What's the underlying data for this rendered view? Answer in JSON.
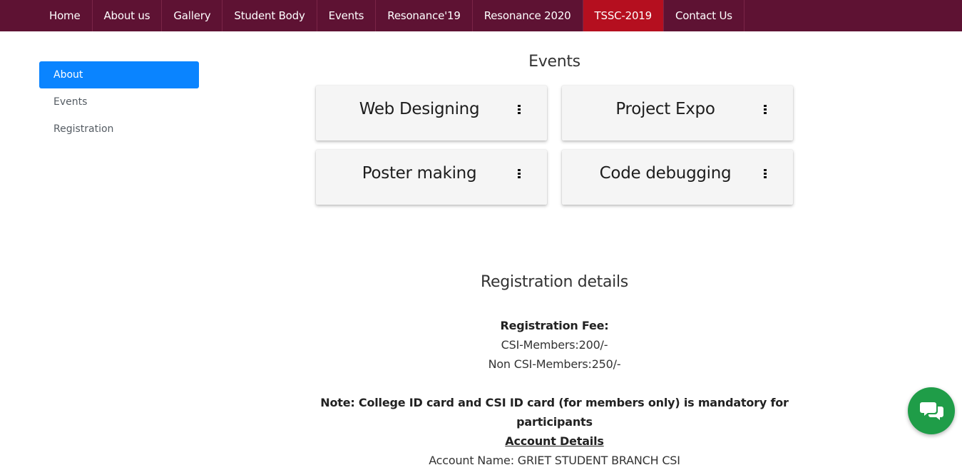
{
  "nav": {
    "items": [
      {
        "label": "Home"
      },
      {
        "label": "About us"
      },
      {
        "label": "Gallery"
      },
      {
        "label": "Student Body"
      },
      {
        "label": "Events"
      },
      {
        "label": "Resonance'19"
      },
      {
        "label": "Resonance 2020"
      },
      {
        "label": "TSSC-2019",
        "active": true
      },
      {
        "label": "Contact Us"
      }
    ]
  },
  "sidebar": {
    "items": [
      {
        "label": "About",
        "active": true
      },
      {
        "label": "Events"
      },
      {
        "label": "Registration"
      }
    ]
  },
  "events": {
    "title": "Events",
    "cards": [
      {
        "title": "Web Designing",
        "menu_icon": "kebab-menu-icon"
      },
      {
        "title": "Project Expo",
        "menu_icon": "kebab-menu-icon"
      },
      {
        "title": "Poster making",
        "menu_icon": "kebab-menu-icon"
      },
      {
        "title": "Code debugging",
        "menu_icon": "kebab-menu-icon"
      }
    ]
  },
  "registration": {
    "title": "Registration details",
    "fee_heading": "Registration Fee:",
    "fee_members": "CSI-Members:200/-",
    "fee_non_members": "Non CSI-Members:250/-",
    "note": "Note: College ID card and CSI ID card (for members only) is mandatory for participants",
    "account_heading": "Account Details",
    "account_name": "Account Name: GRIET STUDENT BRANCH CSI"
  },
  "chat": {
    "icon": "chat-bubbles-icon"
  },
  "colors": {
    "navbar_bg": "#5e1233",
    "nav_active_bg": "#b50f1f",
    "sidebar_active_bg": "#0a84ff",
    "chat_button_bg": "#1f9d48",
    "card_bg": "#f5f5f5"
  }
}
